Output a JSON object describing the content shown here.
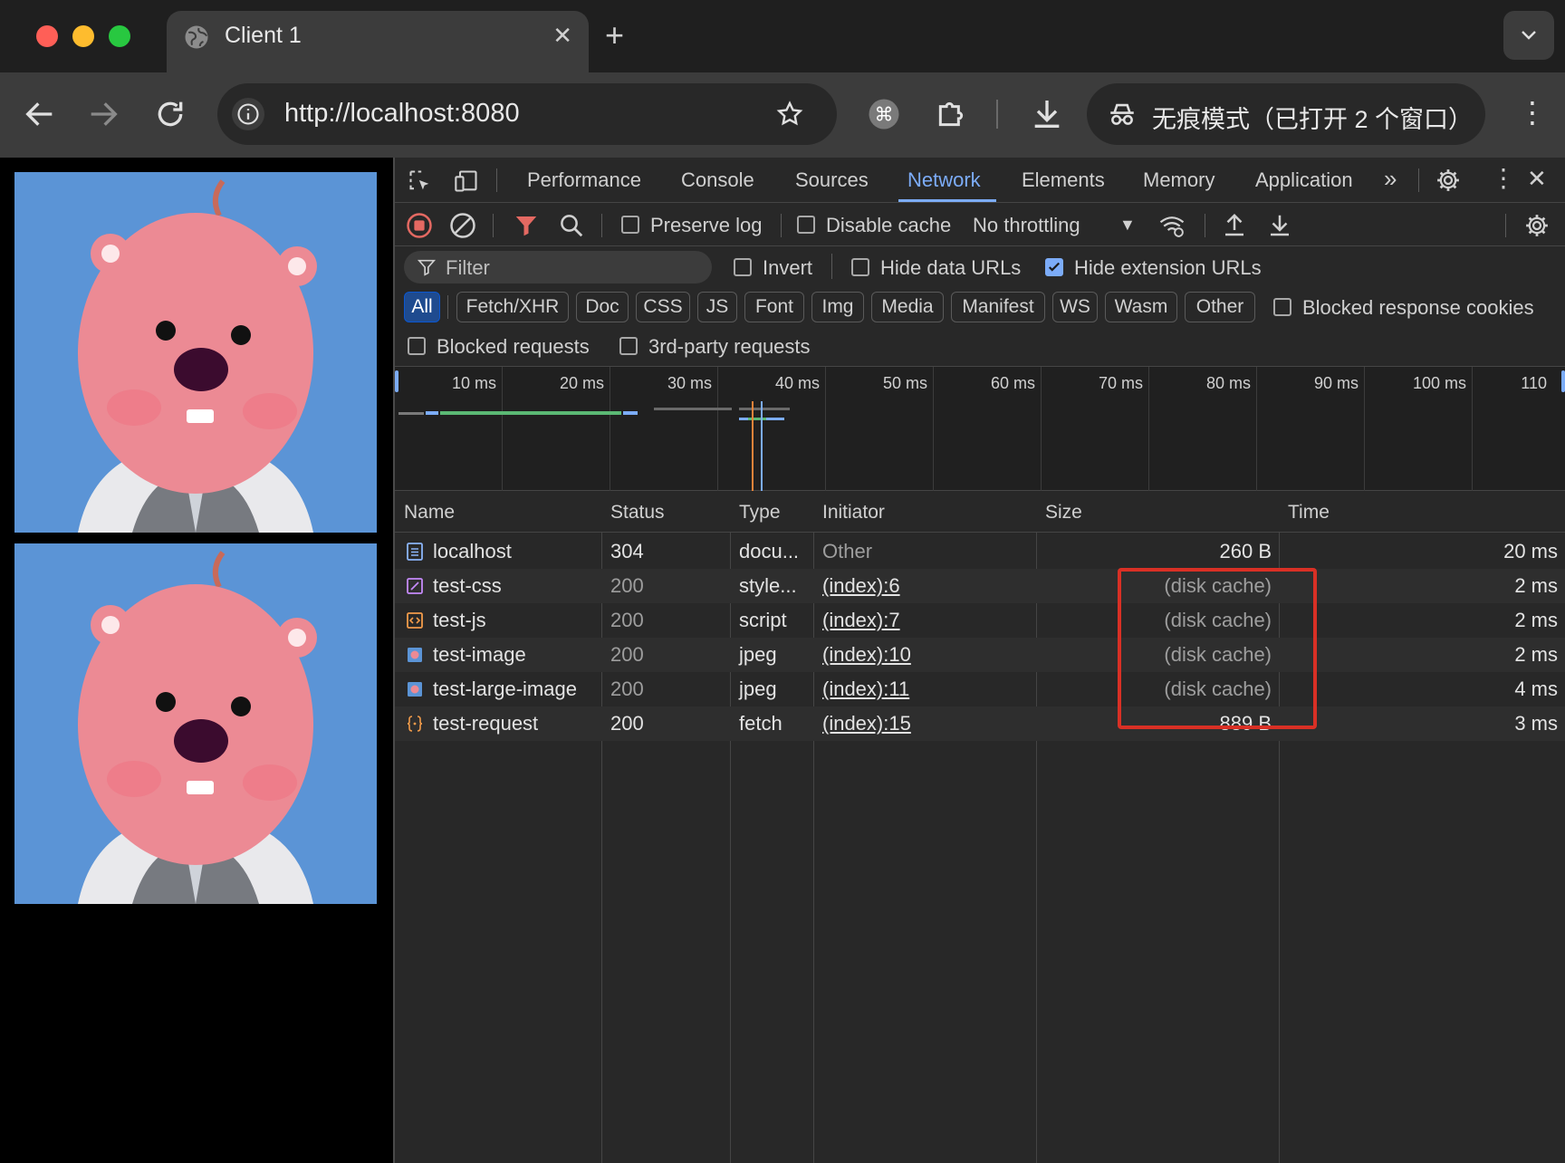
{
  "browser": {
    "tab_title": "Client 1",
    "url": "http://localhost:8080",
    "incognito_label": "无痕模式（已打开 2 个窗口）"
  },
  "devtools": {
    "tabs": [
      "Performance",
      "Console",
      "Sources",
      "Network",
      "Elements",
      "Memory",
      "Application"
    ],
    "active_tab": "Network",
    "toolbar": {
      "preserve_log": "Preserve log",
      "disable_cache": "Disable cache",
      "throttling": "No throttling"
    },
    "filter": {
      "placeholder": "Filter",
      "invert": "Invert",
      "hide_data_urls": "Hide data URLs",
      "hide_extension_urls": "Hide extension URLs",
      "blocked_response_cookies": "Blocked response cookies",
      "blocked_requests": "Blocked requests",
      "third_party_requests": "3rd-party requests"
    },
    "type_chips": [
      "All",
      "Fetch/XHR",
      "Doc",
      "CSS",
      "JS",
      "Font",
      "Img",
      "Media",
      "Manifest",
      "WS",
      "Wasm",
      "Other"
    ],
    "timeline_ticks": [
      "10 ms",
      "20 ms",
      "30 ms",
      "40 ms",
      "50 ms",
      "60 ms",
      "70 ms",
      "80 ms",
      "90 ms",
      "100 ms",
      "110"
    ],
    "columns": {
      "name": "Name",
      "status": "Status",
      "type": "Type",
      "initiator": "Initiator",
      "size": "Size",
      "time": "Time"
    },
    "rows": [
      {
        "name": "localhost",
        "status": "304",
        "type": "docu...",
        "initiator": "Other",
        "size": "260 B",
        "time": "20 ms",
        "icon": "document-icon"
      },
      {
        "name": "test-css",
        "status": "200",
        "type": "style...",
        "initiator": "(index):6",
        "size": "(disk cache)",
        "time": "2 ms",
        "icon": "stylesheet-icon"
      },
      {
        "name": "test-js",
        "status": "200",
        "type": "script",
        "initiator": "(index):7",
        "size": "(disk cache)",
        "time": "2 ms",
        "icon": "script-icon"
      },
      {
        "name": "test-image",
        "status": "200",
        "type": "jpeg",
        "initiator": "(index):10",
        "size": "(disk cache)",
        "time": "2 ms",
        "icon": "image-icon"
      },
      {
        "name": "test-large-image",
        "status": "200",
        "type": "jpeg",
        "initiator": "(index):11",
        "size": "(disk cache)",
        "time": "4 ms",
        "icon": "image-icon"
      },
      {
        "name": "test-request",
        "status": "200",
        "type": "fetch",
        "initiator": "(index):15",
        "size": "889 B",
        "time": "3 ms",
        "icon": "fetch-icon"
      }
    ]
  },
  "colors": {
    "accent": "#7cacf8",
    "highlight_box": "#d93025",
    "image_background": "#5b94d6"
  }
}
